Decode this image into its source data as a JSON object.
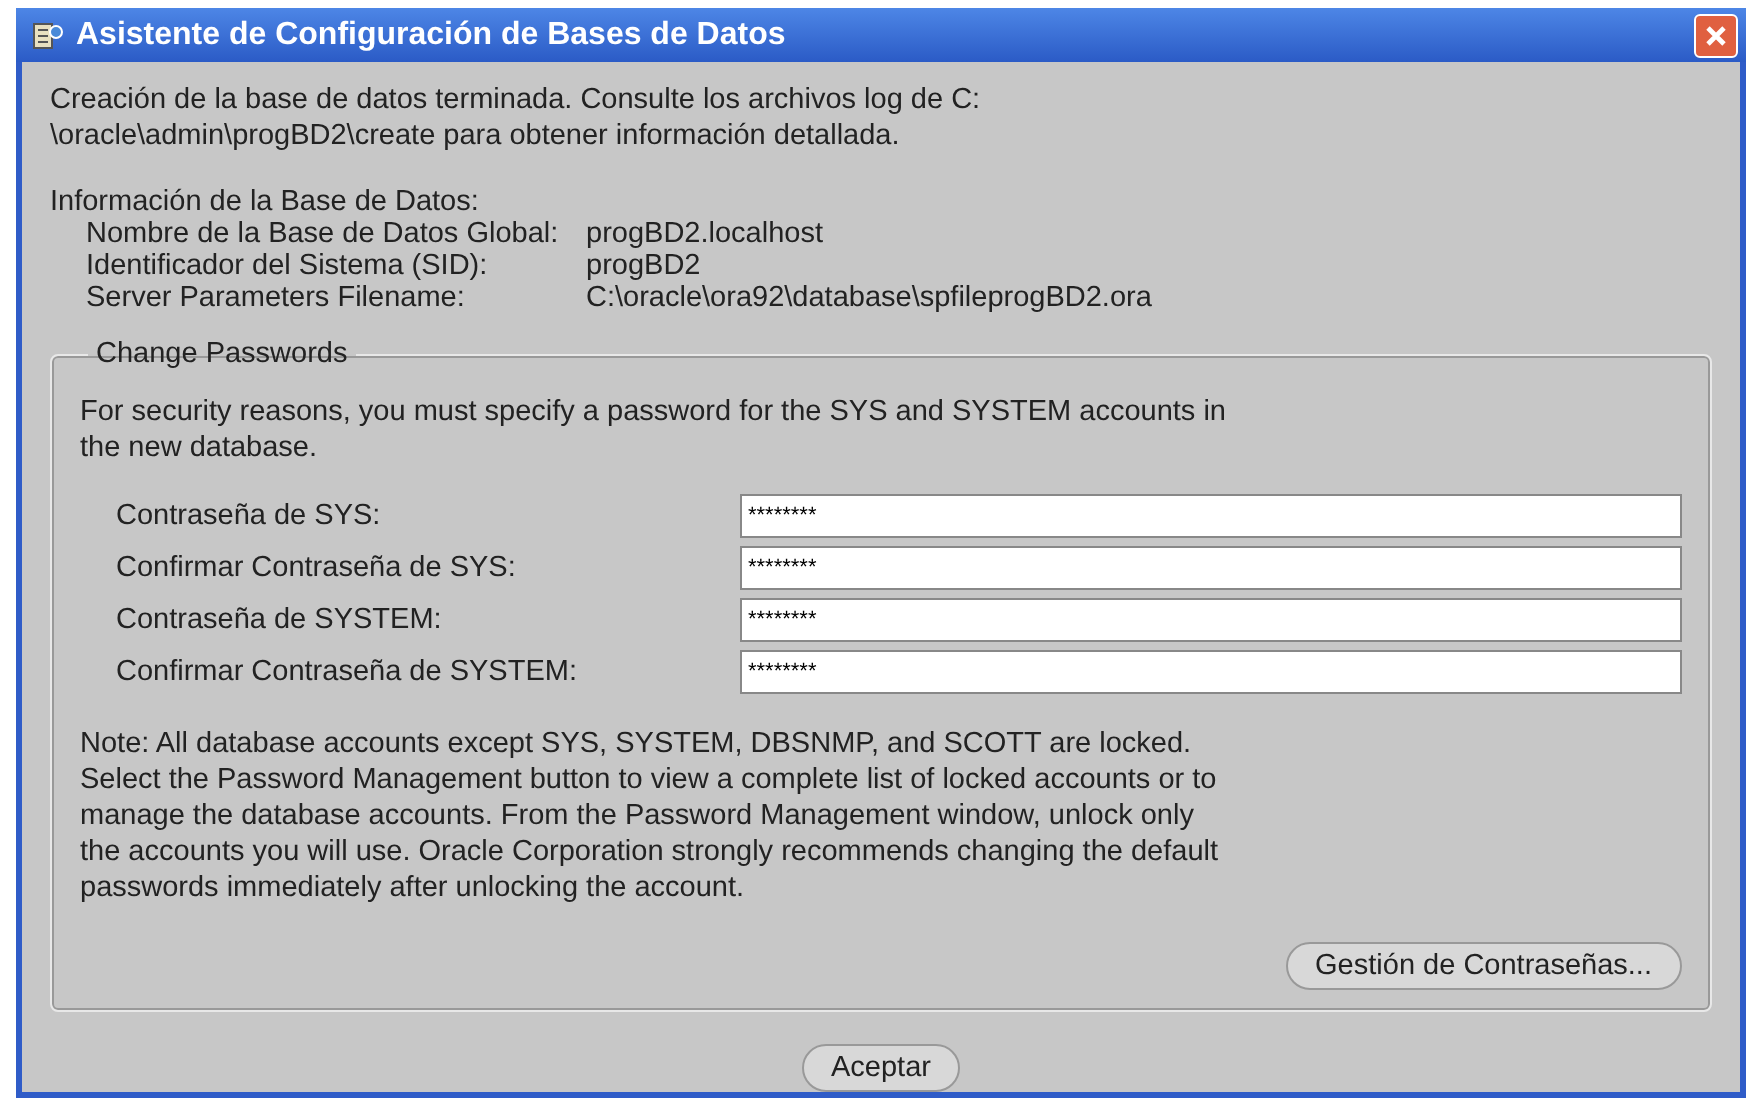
{
  "window": {
    "title": "Asistente de Configuración de Bases de Datos"
  },
  "message_lines": [
    "Creación de la base de datos terminada. Consulte los archivos log de C:",
    "\\oracle\\admin\\progBD2\\create para obtener información detallada."
  ],
  "info": {
    "heading": "Información de la Base de Datos:",
    "rows": [
      {
        "label": "Nombre de la Base de Datos Global:",
        "value": "progBD2.localhost"
      },
      {
        "label": "Identificador del Sistema (SID):",
        "value": "progBD2"
      },
      {
        "label": "Server Parameters Filename:",
        "value": "C:\\oracle\\ora92\\database\\spfileprogBD2.ora"
      }
    ]
  },
  "passwords": {
    "legend": "Change Passwords",
    "intro_lines": [
      "For security reasons, you must specify a password for the SYS and SYSTEM accounts in",
      "the new database."
    ],
    "fields": [
      {
        "label": "Contraseña de SYS:",
        "value": "********"
      },
      {
        "label": "Confirmar Contraseña de SYS:",
        "value": "********"
      },
      {
        "label": "Contraseña de SYSTEM:",
        "value": "********"
      },
      {
        "label": "Confirmar Contraseña de SYSTEM:",
        "value": "********"
      }
    ],
    "note_lines": [
      "Note: All database accounts except SYS, SYSTEM, DBSNMP, and SCOTT are locked.",
      "Select the Password Management button to view a complete list of locked accounts or to",
      "manage the database accounts. From the Password Management window, unlock only",
      "the accounts you will use. Oracle Corporation strongly recommends changing the default",
      "passwords immediately after unlocking the account."
    ],
    "button": "Gestión de Contraseñas..."
  },
  "ok_button": "Aceptar"
}
